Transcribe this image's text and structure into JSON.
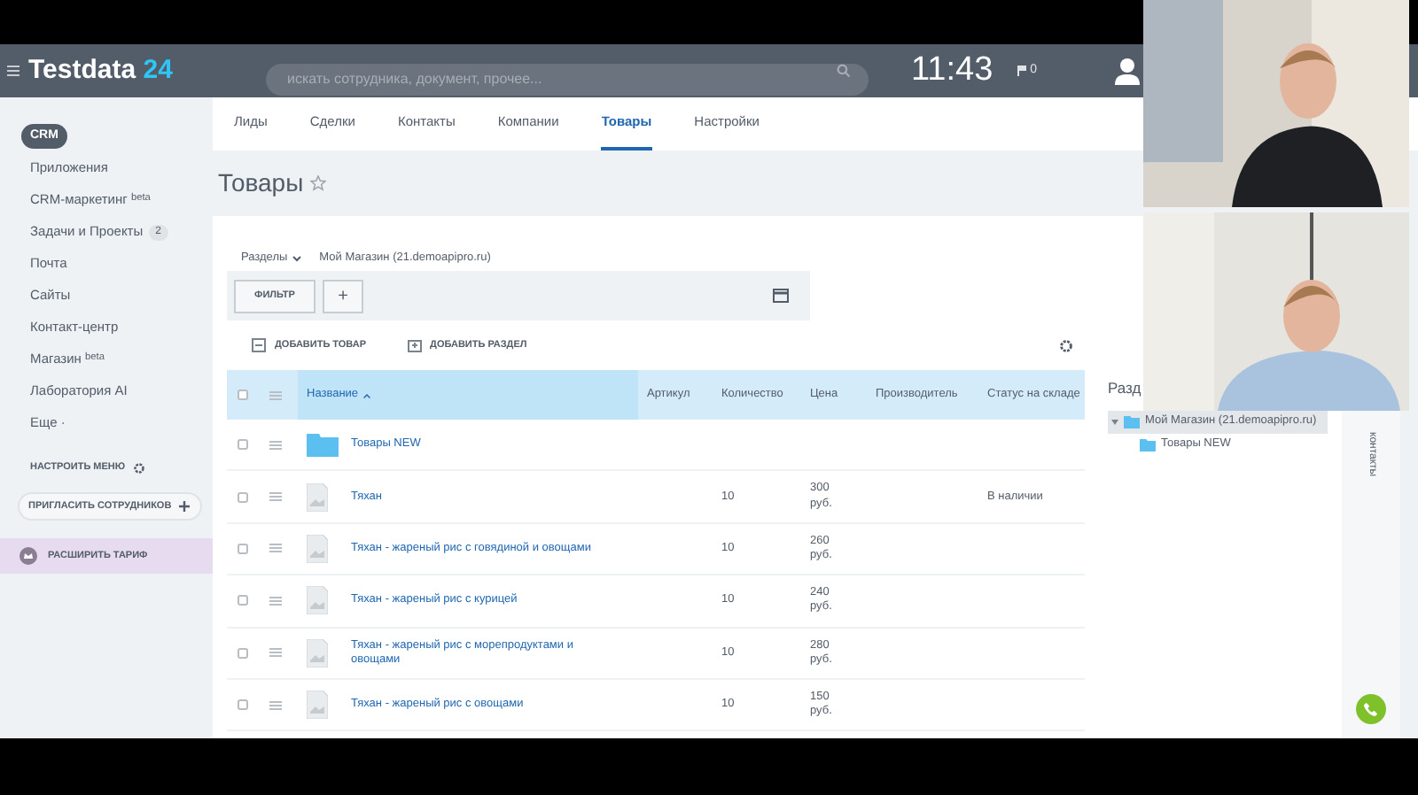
{
  "header": {
    "logo": "Testdata",
    "logo_suffix": "24",
    "search": {
      "placeholder": "искать сотрудника, документ, прочее..."
    },
    "clock": "11:43",
    "notifications": "0"
  },
  "sidebar": {
    "items": [
      {
        "label": "CRM",
        "selected": true
      },
      {
        "label": "Приложения",
        "selected": false
      },
      {
        "label": "CRM-маркетинг $^{beta}$",
        "selected": false
      },
      {
        "label": "Задачи и Проекты",
        "counter": "2",
        "selected": false
      },
      {
        "label": "Почта",
        "selected": false
      },
      {
        "label": "Сайты",
        "selected": false
      },
      {
        "label": "Контакт-центр",
        "selected": false
      },
      {
        "label": "Магазин $^{beta}$",
        "selected": false
      },
      {
        "label": "Лаборатория AI",
        "selected": false
      },
      {
        "label": "Еще ·",
        "selected": false
      }
    ],
    "configure": "НАСТРОИТЬ МЕНЮ",
    "invite": "ПРИГЛАСИТЬ СОТРУДНИКОВ",
    "upgrade": "РАСШИРИТЬ ТАРИФ"
  },
  "tabs": [
    {
      "label": "Лиды",
      "selected": false
    },
    {
      "label": "Сделки",
      "selected": false
    },
    {
      "label": "Контакты",
      "selected": false
    },
    {
      "label": "Компании",
      "selected": false
    },
    {
      "label": "Товары",
      "selected": true
    },
    {
      "label": "Настройки",
      "selected": false
    }
  ],
  "page_title": "Товары",
  "breadcrumb": {
    "sections": "Разделы",
    "path": "Мой Магазин (21.demoapipro.ru)"
  },
  "filter_button": "ФИЛЬТР",
  "add_filter_button": "+",
  "actions": [
    "ДОБАВИТЬ ТОВАР",
    "ДОБАВИТЬ РАЗДЕЛ"
  ],
  "table": {
    "all_checked": false,
    "columns": [
      "Название",
      "Артикул",
      "Количество",
      "Цена",
      "Производитель",
      "Статус на складе"
    ],
    "rows": [
      {
        "kind": "folder",
        "name": "Товары NEW",
        "checked": false
      },
      {
        "kind": "product",
        "name": "Тяхан",
        "quantity": "10",
        "price": "300 руб.",
        "status": "В наличии",
        "checked": false
      },
      {
        "kind": "product",
        "name": "Тяхан - жареный рис с говядиной и овощами",
        "quantity": "10",
        "price": "260 руб.",
        "checked": false
      },
      {
        "kind": "product",
        "name": "Тяхан - жареный рис с курицей",
        "quantity": "10",
        "price": "240 руб.",
        "checked": false
      },
      {
        "kind": "product",
        "name": "Тяхан - жареный рис с морепродуктами и овощами",
        "quantity": "10",
        "price": "280 руб.",
        "checked": false
      },
      {
        "kind": "product",
        "name": "Тяхан - жареный рис с овощами",
        "quantity": "10",
        "price": "150 руб.",
        "checked": false
      }
    ]
  },
  "sections_panel": {
    "title": "Разд",
    "tree": [
      {
        "label": "Мой Магазин (21.demoapipro.ru)",
        "expanded": true,
        "selected": true,
        "children": [
          {
            "label": "Товары NEW",
            "selected": false
          }
        ]
      }
    ]
  },
  "side_strip": "контакты"
}
